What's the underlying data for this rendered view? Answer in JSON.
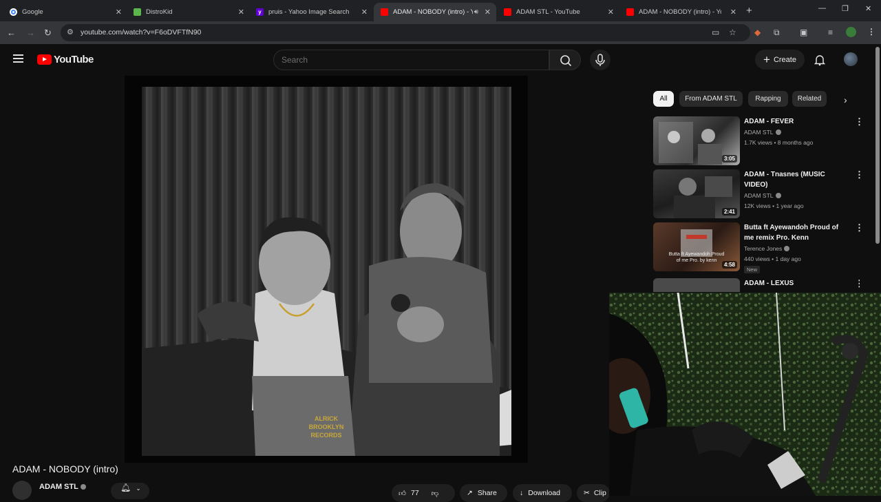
{
  "browser": {
    "tabs": [
      {
        "title": "Google",
        "color": "#4285f4",
        "active": false
      },
      {
        "title": "DistroKid",
        "color": "#5bb54a",
        "active": false
      },
      {
        "title": "pruis - Yahoo Image Search Re",
        "color": "#6001d2",
        "active": false
      },
      {
        "title": "ADAM - NOBODY (intro) - Y",
        "color": "#ff0000",
        "active": true
      },
      {
        "title": "ADAM STL - YouTube",
        "color": "#ff0000",
        "active": false
      },
      {
        "title": "ADAM - NOBODY (intro) - YouT",
        "color": "#ff0000",
        "active": false
      }
    ],
    "url": "youtube.com/watch?v=F6oDVFTfN90"
  },
  "youtube": {
    "logo_text": "YouTube",
    "search_placeholder": "Search",
    "create_label": "Create",
    "chips": [
      "All",
      "From ADAM STL",
      "Rapping",
      "Related"
    ],
    "recommendations": [
      {
        "title": "ADAM - FEVER",
        "channel": "ADAM STL",
        "meta": "1.7K views • 8 months ago",
        "duration": "3:05"
      },
      {
        "title": "ADAM - Tnasnes (MUSIC VIDEO)",
        "channel": "ADAM STL",
        "meta": "12K views • 1 year ago",
        "duration": "2:41"
      },
      {
        "title": "Butta ft Ayewandoh Proud of me remix Pro. Kenn",
        "channel": "Terence Jones",
        "meta": "440 views • 1 day ago",
        "duration": "4:58",
        "badge": "New",
        "thumb_caption": "Butta ft Ayewandoh Proud of me Pro. by kenn"
      },
      {
        "title": "ADAM - LEXUS",
        "channel": "",
        "meta": "",
        "duration": ""
      }
    ],
    "video": {
      "title": "ADAM - NOBODY (intro)",
      "channel": "ADAM STL",
      "subscribers": "",
      "like_count": "77",
      "share_label": "Share",
      "download_label": "Download",
      "clip_label": "Clip",
      "record_label_logo": "ALRICK BROOKLYN RECORDS"
    }
  }
}
